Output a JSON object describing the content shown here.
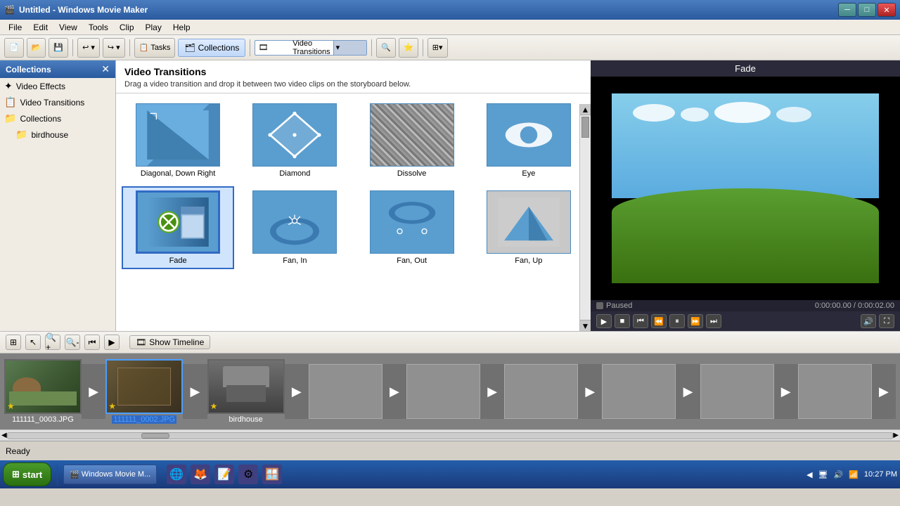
{
  "titlebar": {
    "title": "Untitled - Windows Movie Maker",
    "icon": "🎬",
    "minimize": "─",
    "maximize": "□",
    "close": "✕"
  },
  "menubar": {
    "items": [
      "File",
      "Edit",
      "View",
      "Tools",
      "Clip",
      "Play",
      "Help"
    ]
  },
  "toolbar": {
    "tasks_label": "Tasks",
    "collections_label": "Collections",
    "dropdown_label": "Video Transitions",
    "undo_label": "↩",
    "redo_label": "↪"
  },
  "left_panel": {
    "title": "Collections",
    "items": [
      {
        "label": "Video Effects",
        "icon": "✦"
      },
      {
        "label": "Video Transitions",
        "icon": "📋"
      },
      {
        "label": "Collections",
        "icon": "📁"
      },
      {
        "label": "birdhouse",
        "icon": "📁",
        "indent": true
      }
    ]
  },
  "transitions_panel": {
    "title": "Video Transitions",
    "description": "Drag a video transition and drop it between two video clips on the storyboard below.",
    "items": [
      {
        "name": "Diagonal, Down Right",
        "type": "diagonal"
      },
      {
        "name": "Diamond",
        "type": "diamond"
      },
      {
        "name": "Dissolve",
        "type": "dissolve"
      },
      {
        "name": "Eye",
        "type": "eye"
      },
      {
        "name": "Fade",
        "type": "fade",
        "selected": true
      },
      {
        "name": "Fan, In",
        "type": "fan-in"
      },
      {
        "name": "Fan, Out",
        "type": "fan-out"
      },
      {
        "name": "Fan, Up",
        "type": "fan-up"
      }
    ]
  },
  "preview": {
    "title": "Fade",
    "status": "Paused",
    "time_current": "0:00:00.00",
    "time_total": "0:00:02.00",
    "time_display": "0:00:00.00 / 0:00:02.00"
  },
  "storyboard": {
    "show_timeline_label": "Show Timeline",
    "clips": [
      {
        "name": "111111_0003.JPG",
        "type": "bird",
        "selected": false
      },
      {
        "name": "111111_0002.JPG",
        "type": "war",
        "selected": true
      },
      {
        "name": "birdhouse",
        "type": "house",
        "selected": false
      }
    ]
  },
  "statusbar": {
    "text": "Ready"
  },
  "taskbar": {
    "start_label": "start",
    "items": [
      "🎬 Windows Movie M..."
    ],
    "time": "10:27 PM",
    "icons": [
      "🔊",
      "🖥",
      "📶",
      "💬"
    ]
  }
}
